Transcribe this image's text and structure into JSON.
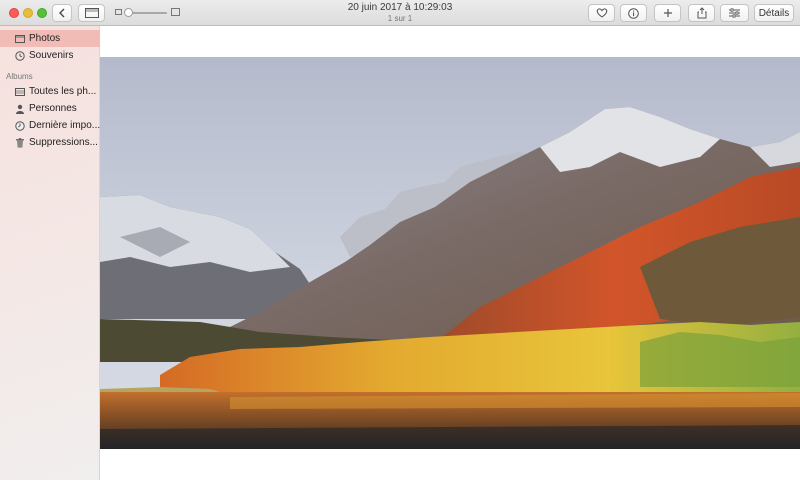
{
  "window": {
    "title_date": "20 juin 2017 à 10:29:03",
    "title_count": "1 sur 1"
  },
  "toolbar": {
    "details_label": "Détails"
  },
  "sidebar": {
    "items": [
      {
        "label": "Photos",
        "icon": "photos-icon",
        "selected": true
      },
      {
        "label": "Souvenirs",
        "icon": "memories-icon",
        "selected": false
      }
    ],
    "albums_header": "Albums",
    "albums": [
      {
        "label": "Toutes les ph...",
        "icon": "album-icon"
      },
      {
        "label": "Personnes",
        "icon": "person-icon"
      },
      {
        "label": "Dernière impo...",
        "icon": "clock-icon"
      },
      {
        "label": "Suppressions...",
        "icon": "trash-icon"
      }
    ]
  },
  "colors": {
    "selection": "#f1bcb5",
    "sidebar": "#f4e6e3",
    "close": "#fc5b57",
    "minimize": "#e5bf3c",
    "maximize": "#57c038"
  }
}
